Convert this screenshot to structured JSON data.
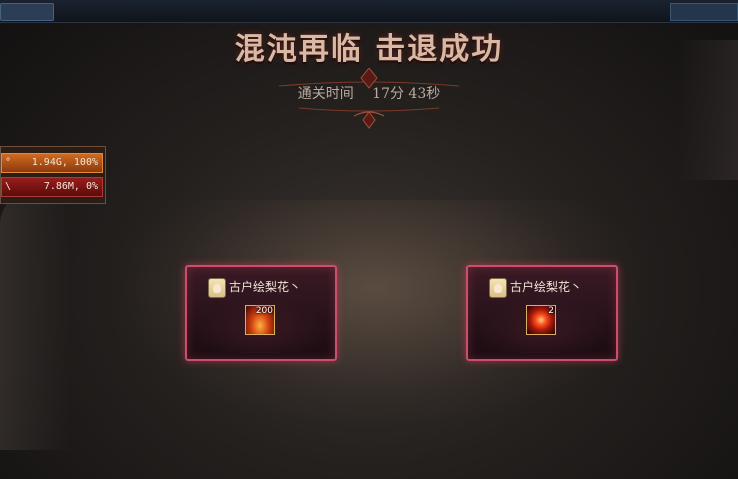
{
  "result": {
    "title": "混沌再临 击退成功",
    "clear_time_label": "通关时间",
    "clear_time_value": "17分 43秒"
  },
  "stats": [
    {
      "mark": "°",
      "value": "1.94G, 100%",
      "color": "#d06a20"
    },
    {
      "mark": "\\",
      "value": "7.86M, 0%",
      "color": "#9a1c1c"
    }
  ],
  "reward_cards": [
    {
      "player_name": "古户绘梨花丶",
      "item_icon": "flame-item-icon",
      "item_qty": "200"
    },
    {
      "player_name": "古户绘梨花丶",
      "item_icon": "orb-item-icon",
      "item_qty": "2"
    }
  ],
  "colors": {
    "title": "#d8b9a6",
    "card_border": "#c8506c",
    "hp_bar": "#d06a20",
    "mp_bar": "#9a1c1c"
  }
}
